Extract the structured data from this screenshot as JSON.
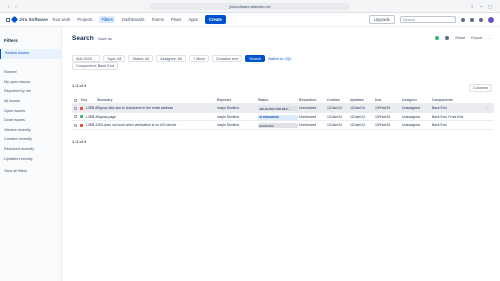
{
  "browser": {
    "url": "jiracsoftware.atlassian.net"
  },
  "app": {
    "name": "Jira Software",
    "nav": [
      "Your work",
      "Projects",
      "Filters",
      "Dashboards",
      "Teams",
      "Plans",
      "Apps"
    ],
    "active_nav_index": 2,
    "create_label": "Create",
    "upgrade_label": "Upgrade",
    "search_placeholder": "Search"
  },
  "sidebar": {
    "title": "Filters",
    "items": [
      "Search issues",
      "",
      "Starred",
      "My open issues",
      "Reported by me",
      "All issues",
      "Open issues",
      "Done issues",
      "Viewed recently",
      "Created recently",
      "Resolved recently",
      "Updated recently"
    ],
    "selected_index": 0,
    "view_all": "View all filters"
  },
  "page": {
    "title": "Search",
    "save_as": "Save as",
    "share_label": "Share",
    "export_label": "Export",
    "filters": {
      "project_key": "AUL2024",
      "type": "Type: All",
      "status": "Status: All",
      "assignee": "Assignee: All",
      "more": "+ More",
      "contains": "Contains text",
      "search_button": "Search",
      "switch_jql": "Switch to JQL",
      "component": "Component: Back End"
    },
    "result_count": "1–3 of 3",
    "columns_label": "Columns"
  },
  "table": {
    "headers": [
      "Key",
      "Summary",
      "Reporter",
      "Status",
      "Resolution",
      "Created",
      "Updated",
      "Due",
      "Assignee",
      "Components"
    ],
    "rows": [
      {
        "type": "bug",
        "key": "L3EB-6",
        "summary": "Signup fails due to characters in the email address",
        "reporter": "Ivaylo Dimitrov",
        "status": "SELECTED FOR DEV...",
        "resolution": "Unresolved",
        "created": "12/Jan/24",
        "updated": "12/Jan/24",
        "due": "19/Feb/24",
        "assignee": "Unassigned",
        "components": "Back End"
      },
      {
        "type": "story",
        "key": "L3EB-4",
        "summary": "Signup page",
        "reporter": "Ivaylo Dimitrov",
        "status": "IN PROGRESS",
        "resolution": "Unresolved",
        "created": "12/Jan/24",
        "updated": "12/Jan/24",
        "due": "19/Feb/24",
        "assignee": "Unassigned",
        "components": "Back End, Front End"
      },
      {
        "type": "bug",
        "key": "L3EB-3",
        "summary": "JFA does not work when verification is on iOS device",
        "reporter": "Ivaylo Dimitrov",
        "status": "BACKLOG",
        "resolution": "Unresolved",
        "created": "12/Jan/24",
        "updated": "12/Jan/24",
        "due": "19/Feb/24",
        "assignee": "Unassigned",
        "components": "Back End"
      }
    ]
  }
}
